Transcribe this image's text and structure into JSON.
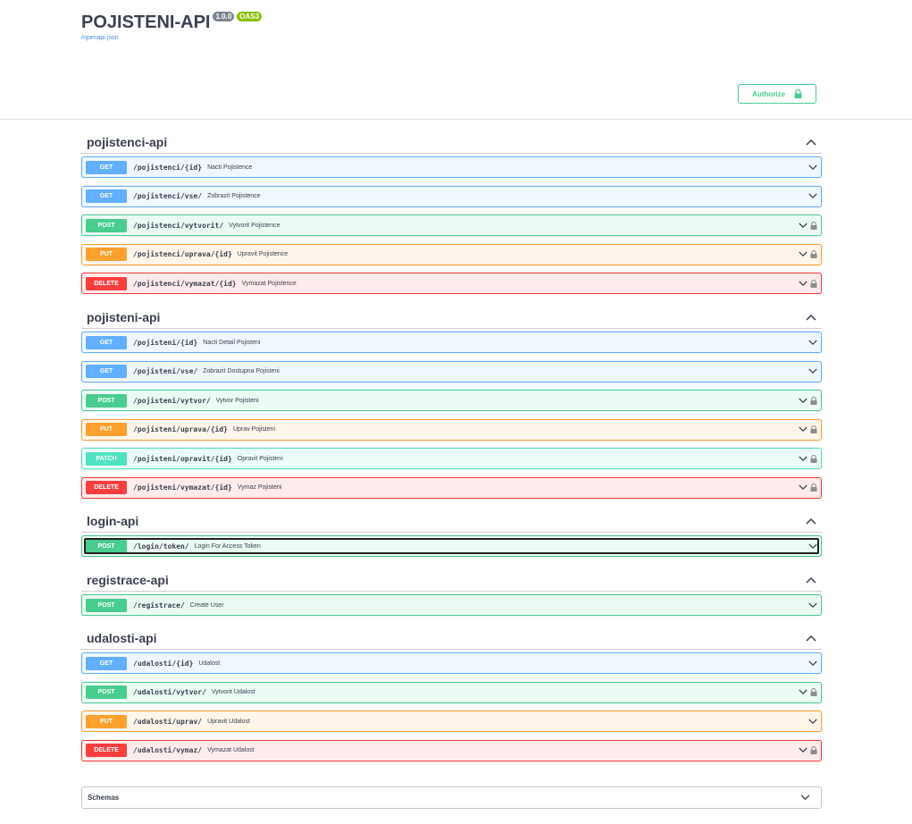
{
  "info": {
    "title": "POJISTENI-API",
    "version": "1.0.0",
    "oas_badge": "OAS3",
    "spec_link": "/openapi.json"
  },
  "authorize": {
    "label": "Authorize",
    "icon": "lock-icon"
  },
  "colors": {
    "get": "#61affe",
    "post": "#49cc90",
    "put": "#fca130",
    "delete": "#f93e3e",
    "patch": "#50e3c2"
  },
  "tags": [
    {
      "name": "pojistenci-api",
      "ops": [
        {
          "method": "GET",
          "path": "/pojistenci/{id}",
          "summary": "Nacti Pojistence",
          "locked": false
        },
        {
          "method": "GET",
          "path": "/pojistenci/vse/",
          "summary": "Zobrazit Pojistence",
          "locked": false
        },
        {
          "method": "POST",
          "path": "/pojistenci/vytvorit/",
          "summary": "Vytvorit Pojistence",
          "locked": true
        },
        {
          "method": "PUT",
          "path": "/pojistenci/uprava/{id}",
          "summary": "Upravit Pojistence",
          "locked": true
        },
        {
          "method": "DELETE",
          "path": "/pojistenci/vymazat/{id}",
          "summary": "Vymazat Pojistence",
          "locked": true
        }
      ]
    },
    {
      "name": "pojisteni-api",
      "ops": [
        {
          "method": "GET",
          "path": "/pojisteni/{id}",
          "summary": "Nacti Detail Pojisteni",
          "locked": false
        },
        {
          "method": "GET",
          "path": "/pojisteni/vse/",
          "summary": "Zobrazit Dostupna Pojisteni",
          "locked": false
        },
        {
          "method": "POST",
          "path": "/pojisteni/vytvor/",
          "summary": "Vytvor Pojisteni",
          "locked": true
        },
        {
          "method": "PUT",
          "path": "/pojisteni/uprava/{id}",
          "summary": "Uprav Pojisteni",
          "locked": true
        },
        {
          "method": "PATCH",
          "path": "/pojisteni/opravit/{id}",
          "summary": "Opravit Pojisteni",
          "locked": true
        },
        {
          "method": "DELETE",
          "path": "/pojisteni/vymazat/{id}",
          "summary": "Vymaz Pojisteni",
          "locked": true
        }
      ]
    },
    {
      "name": "login-api",
      "ops": [
        {
          "method": "POST",
          "path": "/login/token/",
          "summary": "Login For Access Token",
          "locked": false,
          "focused": true
        }
      ]
    },
    {
      "name": "registrace-api",
      "ops": [
        {
          "method": "POST",
          "path": "/registrace/",
          "summary": "Create User",
          "locked": false
        }
      ]
    },
    {
      "name": "udalosti-api",
      "ops": [
        {
          "method": "GET",
          "path": "/udalosti/{id}",
          "summary": "Udalost",
          "locked": false
        },
        {
          "method": "POST",
          "path": "/udalosti/vytvor/",
          "summary": "Vytvorit Udalost",
          "locked": true
        },
        {
          "method": "PUT",
          "path": "/udalosti/uprav/",
          "summary": "Upravit Udalost",
          "locked": false
        },
        {
          "method": "DELETE",
          "path": "/udalosti/vymaz/",
          "summary": "Vymazat Udalost",
          "locked": true
        }
      ]
    }
  ],
  "schemas": {
    "label": "Schemas"
  }
}
